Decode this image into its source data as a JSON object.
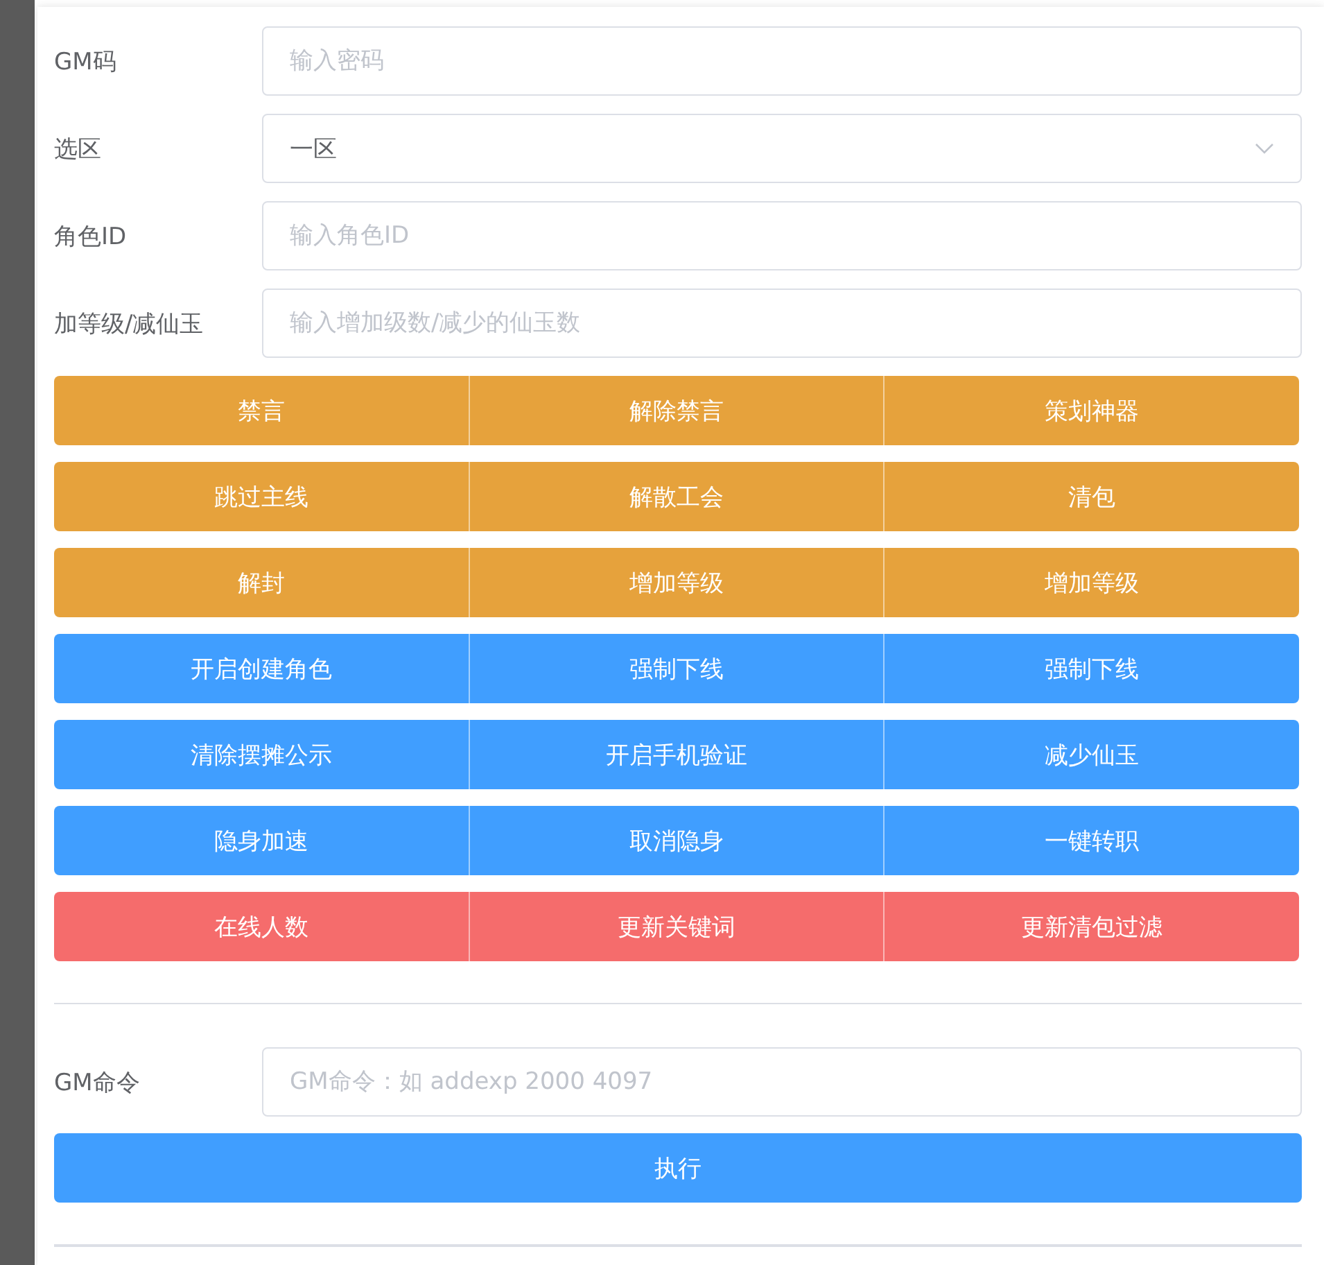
{
  "fields": [
    {
      "kind": "input",
      "label": "GM码",
      "placeholder": "输入密码"
    },
    {
      "kind": "select",
      "label": "选区",
      "value": "一区"
    },
    {
      "kind": "input",
      "label": "角色ID",
      "placeholder": "输入角色ID"
    },
    {
      "kind": "input",
      "label": "加等级/减仙玉",
      "placeholder": "输入增加级数/减少的仙玉数"
    }
  ],
  "button_rows": [
    [
      {
        "label": "禁言",
        "kind": "warning"
      },
      {
        "label": "解除禁言",
        "kind": "warning"
      },
      {
        "label": "策划神器",
        "kind": "warning"
      }
    ],
    [
      {
        "label": "跳过主线",
        "kind": "warning"
      },
      {
        "label": "解散工会",
        "kind": "warning"
      },
      {
        "label": "清包",
        "kind": "warning"
      }
    ],
    [
      {
        "label": "解封",
        "kind": "warning"
      },
      {
        "label": "增加等级",
        "kind": "warning"
      },
      {
        "label": "增加等级",
        "kind": "warning"
      }
    ],
    [
      {
        "label": "开启创建角色",
        "kind": "primary"
      },
      {
        "label": "强制下线",
        "kind": "primary"
      },
      {
        "label": "强制下线",
        "kind": "primary"
      }
    ],
    [
      {
        "label": "清除摆摊公示",
        "kind": "primary"
      },
      {
        "label": "开启手机验证",
        "kind": "primary"
      },
      {
        "label": "减少仙玉",
        "kind": "primary"
      }
    ],
    [
      {
        "label": "隐身加速",
        "kind": "primary"
      },
      {
        "label": "取消隐身",
        "kind": "primary"
      },
      {
        "label": "一键转职",
        "kind": "primary"
      }
    ],
    [
      {
        "label": "在线人数",
        "kind": "danger"
      },
      {
        "label": "更新关键词",
        "kind": "danger"
      },
      {
        "label": "更新清包过滤",
        "kind": "danger"
      }
    ]
  ],
  "command": {
    "label": "GM命令",
    "placeholder": "GM命令：如 addexp 2000 4097"
  },
  "execute_button": {
    "label": "执行"
  }
}
